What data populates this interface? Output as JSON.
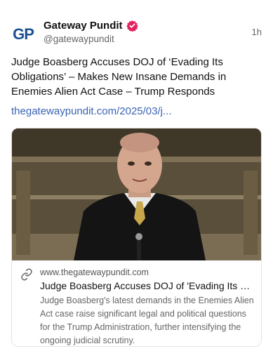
{
  "account": {
    "avatar_text": "GP",
    "display_name": "Gateway Pundit",
    "handle": "@gatewaypundit",
    "verified_icon": "verified-badge-icon",
    "timestamp": "1h"
  },
  "post": {
    "text": "Judge Boasberg Accuses DOJ of ‘Evading Its Obligations’ – Makes New Insane Demands in Enemies Alien Act Case – Trump Responds",
    "link_text": "thegatewaypundit.com/2025/03/j..."
  },
  "card": {
    "link_icon": "link-icon",
    "domain": "www.thegatewaypundit.com",
    "title": "Judge Boasberg Accuses DOJ of 'Evading Its Obligations' – Makes New Insane Demands in Enemies Alien Act Case",
    "description": "Judge Boasberg's latest demands in the Enemies Alien Act case raise significant legal and political questions for the Trump Administration, further intensifying the ongoing judicial scrutiny."
  },
  "colors": {
    "brand_blue": "#1d4f91",
    "verified_red": "#e0245e",
    "link_blue": "#3b63b5"
  }
}
